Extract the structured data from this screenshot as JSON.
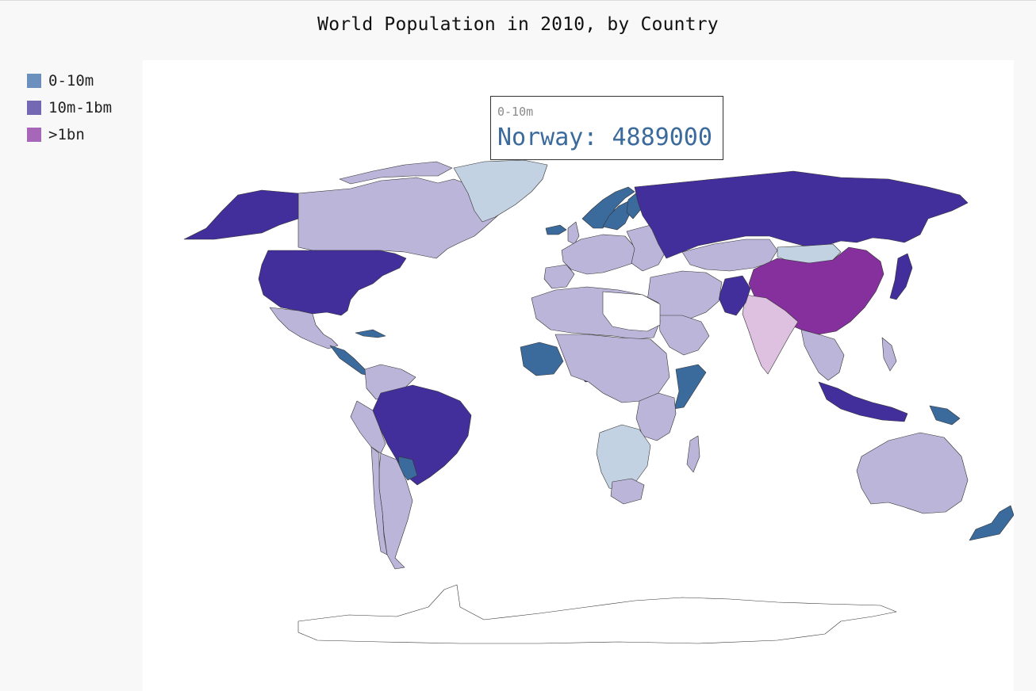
{
  "title": "World Population in 2010, by Country",
  "legend": [
    {
      "label": "0-10m",
      "color": "#6b90bd"
    },
    {
      "label": "10m-1bm",
      "color": "#7467b4"
    },
    {
      "label": ">1bn",
      "color": "#a667b8"
    }
  ],
  "tooltip": {
    "label": "0-10m",
    "value": "Norway: 4889000"
  },
  "colors": {
    "unknown": "#ffffff",
    "range_high": "#432f9b",
    "range_low": "#bbb6d9",
    "small_light": "#c2d2e2",
    "small_dark": "#3b6a9c",
    "billion": "#86309e",
    "billion_light": "#dec0e0"
  },
  "chart_data": {
    "type": "map",
    "map": "world",
    "legend_placement": "left",
    "series": [
      {
        "name": "0-10m",
        "color": "#6b90bd",
        "highlighted": [
          "Norway"
        ]
      },
      {
        "name": "10m-1bm",
        "color": "#7467b4"
      },
      {
        "name": ">1bn",
        "color": "#a667b8",
        "countries": [
          "China",
          "India"
        ]
      }
    ],
    "highlight": {
      "country": "Norway",
      "population": 4889000
    }
  }
}
